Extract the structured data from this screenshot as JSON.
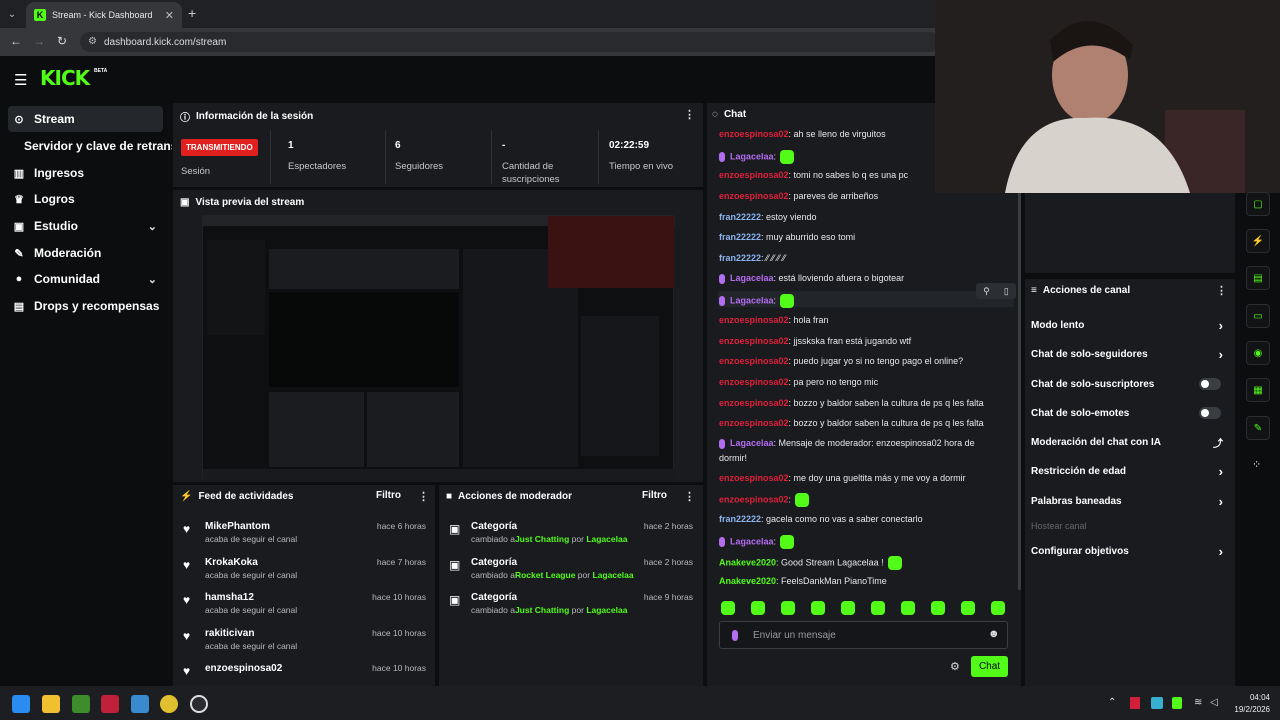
{
  "browser": {
    "tab_title": "Stream - Kick Dashboard",
    "url": "dashboard.kick.com/stream"
  },
  "app": {
    "logo": "KICK",
    "logo_badge": "BETA"
  },
  "sidebar": {
    "items": [
      {
        "label": "Stream",
        "icon": "stream-icon"
      },
      {
        "label": "Servidor y clave de retransm"
      },
      {
        "label": "Ingresos",
        "icon": "chart-icon"
      },
      {
        "label": "Logros",
        "icon": "trophy-icon"
      },
      {
        "label": "Estudio",
        "icon": "video-icon"
      },
      {
        "label": "Moderación",
        "icon": "wrench-icon"
      },
      {
        "label": "Comunidad",
        "icon": "users-icon"
      },
      {
        "label": "Drops y recompensas",
        "icon": "gift-icon"
      }
    ]
  },
  "session": {
    "title": "Información de la sesión",
    "status": "TRANSMITIENDO",
    "status_label": "Sesión",
    "stats": [
      {
        "value": "1",
        "label": "Espectadores"
      },
      {
        "value": "6",
        "label": "Seguidores"
      },
      {
        "value": "-",
        "label": "Cantidad de suscripciones"
      },
      {
        "value": "02:22:59",
        "label": "Tiempo en vivo"
      }
    ]
  },
  "preview": {
    "title": "Vista previa del stream"
  },
  "feed": {
    "title": "Feed de actividades",
    "filter": "Filtro",
    "items": [
      {
        "name": "MikePhantom",
        "sub": "acaba de seguir el canal",
        "time": "hace 6 horas"
      },
      {
        "name": "KrokaKoka",
        "sub": "acaba de seguir el canal",
        "time": "hace 7 horas"
      },
      {
        "name": "hamsha12",
        "sub": "acaba de seguir el canal",
        "time": "hace 10 horas"
      },
      {
        "name": "rakiticivan",
        "sub": "acaba de seguir el canal",
        "time": "hace 10 horas"
      },
      {
        "name": "enzoespinosa02",
        "sub": "",
        "time": "hace 10 horas"
      }
    ]
  },
  "modactions": {
    "title": "Acciones de moderador",
    "filter": "Filtro",
    "items": [
      {
        "title": "Categoría",
        "pre": "cambiado a",
        "game": "Just Chatting",
        "por": "por",
        "user": "Lagacelaa",
        "time": "hace 2 horas"
      },
      {
        "title": "Categoría",
        "pre": "cambiado a",
        "game": "Rocket League",
        "por": "por",
        "user": "Lagacelaa",
        "time": "hace 2 horas"
      },
      {
        "title": "Categoría",
        "pre": "cambiado a",
        "game": "Just Chatting",
        "por": "por",
        "user": "Lagacelaa",
        "time": "hace 9 horas"
      }
    ]
  },
  "chat": {
    "title": "Chat",
    "messages": [
      {
        "user": "enzoespinosa02",
        "color": "red",
        "text": ": ah se lleno de virguitos"
      },
      {
        "user": "Lagacelaa",
        "color": "purple",
        "text": ":",
        "emote": true,
        "mic": true
      },
      {
        "user": "enzoespinosa02",
        "color": "red",
        "text": ": tomi no sabes lo q es una pc"
      },
      {
        "user": "enzoespinosa02",
        "color": "red",
        "text": ": pareves de arribeños"
      },
      {
        "user": "fran22222",
        "color": "blue",
        "text": ": estoy viendo"
      },
      {
        "user": "fran22222",
        "color": "blue",
        "text": ": muy aburrido eso tomi"
      },
      {
        "user": "fran22222",
        "color": "blue",
        "text": ": ⁄⁄ ⁄⁄ ⁄⁄ ⁄⁄"
      },
      {
        "user": "Lagacelaa",
        "color": "purple",
        "text": ": está lloviendo afuera o bigotear",
        "mic": true
      },
      {
        "user": "Lagacelaa",
        "color": "purple",
        "text": ":",
        "emote": true,
        "mic": true
      },
      {
        "user": "enzoespinosa02",
        "color": "red",
        "text": ": hola fran"
      },
      {
        "user": "enzoespinosa02",
        "color": "red",
        "text": ": jjsskska fran está jugando wtf"
      },
      {
        "user": "enzoespinosa02",
        "color": "red",
        "text": ": puedo jugar yo si no tengo pago el online?"
      },
      {
        "user": "enzoespinosa02",
        "color": "red",
        "text": ": pa pero no tengo mic"
      },
      {
        "user": "enzoespinosa02",
        "color": "red",
        "text": ": bozzo y baldor saben la cultura de ps q les falta"
      },
      {
        "user": "enzoespinosa02",
        "color": "red",
        "text": ": bozzo y baldor saben la cultura de ps q les falta"
      },
      {
        "user": "Lagacelaa",
        "color": "purple",
        "text": ": Mensaje de moderador: enzoespinosa02 hora de",
        "text2": "dormir!",
        "mic": true
      },
      {
        "user": "enzoespinosa02",
        "color": "red",
        "text": ": me doy una gueltita más y me voy a dormir"
      },
      {
        "user": "enzoespinosa02",
        "color": "red",
        "text": ":",
        "emote": true
      },
      {
        "user": "fran22222",
        "color": "blue",
        "text": ": gacela como no vas a saber conectarlo"
      },
      {
        "user": "Lagacelaa",
        "color": "purple",
        "text": ":",
        "emote": true,
        "mic": true
      },
      {
        "user": "Anakeve2020",
        "color": "green",
        "text": ": Good Stream Lagacelaa !",
        "emote": true
      },
      {
        "user": "Anakeve2020",
        "color": "green",
        "text": ": FeelsDankMan PianoTime"
      }
    ],
    "input_placeholder": "Enviar un mensaje",
    "send_label": "Chat"
  },
  "channel_actions": {
    "title": "Acciones de canal",
    "items": [
      {
        "label": "Modo lento",
        "control": "chevron"
      },
      {
        "label": "Chat de solo-seguidores",
        "control": "chevron"
      },
      {
        "label": "Chat de solo-suscriptores",
        "control": "toggle"
      },
      {
        "label": "Chat de solo-emotes",
        "control": "toggle"
      },
      {
        "label": "Moderación del chat con IA",
        "control": "chart"
      },
      {
        "label": "Restricción de edad",
        "control": "chevron"
      },
      {
        "label": "Palabras baneadas",
        "control": "chevron"
      },
      {
        "label": "Hostear canal",
        "control": "none",
        "disabled": true
      },
      {
        "label": "Configurar objetivos",
        "control": "chevron"
      }
    ]
  },
  "taskbar": {
    "time": "04:04",
    "date": "19/2/2026"
  }
}
